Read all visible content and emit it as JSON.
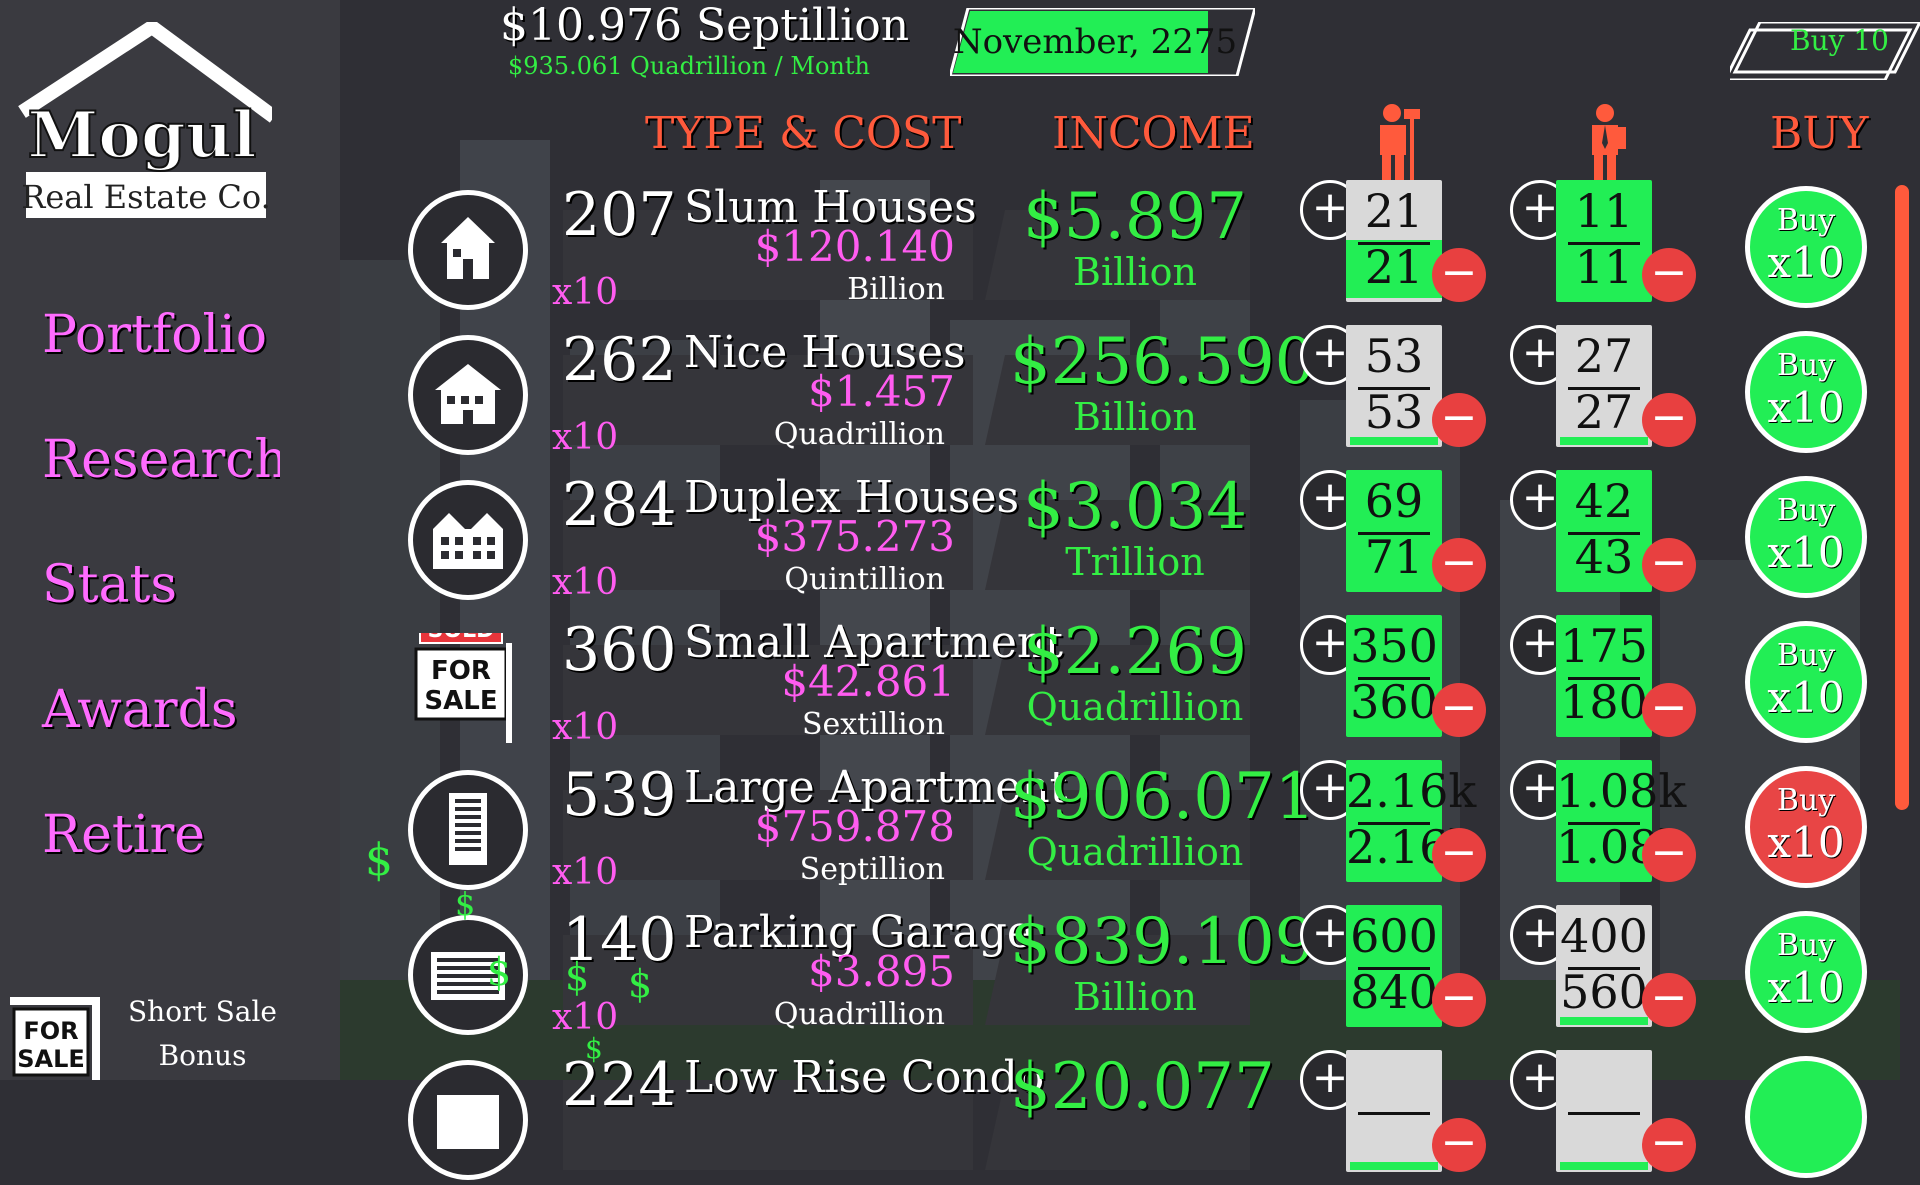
{
  "header": {
    "money": "$10.976 Septillion",
    "rate": "$935.061 Quadrillion / Month",
    "date": "November, 2275",
    "buy_mode": "Buy 10"
  },
  "logo": {
    "title": "Mogul",
    "subtitle": "Real Estate Co."
  },
  "sidebar": {
    "items": [
      "Portfolio",
      "Research",
      "Stats",
      "Awards",
      "Retire"
    ],
    "short_sale": [
      "Short Sale",
      "Bonus"
    ],
    "for_sale_sign": [
      "FOR",
      "SALE"
    ]
  },
  "columns": {
    "type_cost": "TYPE & COST",
    "income": "INCOME",
    "buy": "BUY"
  },
  "sold_sign": {
    "sold": "SOLD",
    "for": "FOR",
    "sale": "SALE"
  },
  "properties": [
    {
      "qty": "207",
      "name": "Slum Houses",
      "cost": "$120.140",
      "cost_unit": "Billion",
      "mult": "x10",
      "income": "$5.897",
      "income_unit": "Billion",
      "workers": [
        "21",
        "21"
      ],
      "managers": [
        "11",
        "11"
      ],
      "buy1": "Buy",
      "buy2": "x10",
      "icon": "house-icon"
    },
    {
      "qty": "262",
      "name": "Nice Houses",
      "cost": "$1.457",
      "cost_unit": "Quadrillion",
      "mult": "x10",
      "income": "$256.590",
      "income_unit": "Billion",
      "workers": [
        "53",
        "53"
      ],
      "managers": [
        "27",
        "27"
      ],
      "buy1": "Buy",
      "buy2": "x10",
      "icon": "nice-house-icon"
    },
    {
      "qty": "284",
      "name": "Duplex Houses",
      "cost": "$375.273",
      "cost_unit": "Quintillion",
      "mult": "x10",
      "income": "$3.034",
      "income_unit": "Trillion",
      "workers": [
        "69",
        "71"
      ],
      "managers": [
        "42",
        "43"
      ],
      "buy1": "Buy",
      "buy2": "x10",
      "icon": "duplex-icon"
    },
    {
      "qty": "360",
      "name": "Small Apartment",
      "cost": "$42.861",
      "cost_unit": "Sextillion",
      "mult": "x10",
      "income": "$2.269",
      "income_unit": "Quadrillion",
      "workers": [
        "350",
        "360"
      ],
      "managers": [
        "175",
        "180"
      ],
      "buy1": "Buy",
      "buy2": "x10",
      "icon": "for-sale-sign-icon"
    },
    {
      "qty": "539",
      "name": "Large Apartment",
      "cost": "$759.878",
      "cost_unit": "Septillion",
      "mult": "x10",
      "income": "$906.071",
      "income_unit": "Quadrillion",
      "workers": [
        "2.16k",
        "2.16k"
      ],
      "managers": [
        "1.08k",
        "1.08k"
      ],
      "buy1": "Buy",
      "buy2": "x10",
      "icon": "apartment-tower-icon"
    },
    {
      "qty": "140",
      "name": "Parking Garage",
      "cost": "$3.895",
      "cost_unit": "Quadrillion",
      "mult": "x10",
      "income": "$839.109",
      "income_unit": "Billion",
      "workers": [
        "600",
        "840"
      ],
      "managers": [
        "400",
        "560"
      ],
      "buy1": "Buy",
      "buy2": "x10",
      "icon": "parking-garage-icon"
    },
    {
      "qty": "224",
      "name": "Low Rise Condo",
      "cost": "",
      "cost_unit": "",
      "mult": "",
      "income": "$20.077",
      "income_unit": "",
      "workers": [
        "",
        ""
      ],
      "managers": [
        "",
        ""
      ],
      "buy1": "",
      "buy2": "",
      "icon": "condo-icon"
    }
  ],
  "colors": {
    "green": "#22ee55",
    "pink": "#ff5cf0",
    "orange": "#ff5a3c",
    "red": "#e84040",
    "bg": "#2f2f35"
  },
  "symbols": {
    "plus": "+",
    "minus": "−",
    "dollar": "$"
  }
}
